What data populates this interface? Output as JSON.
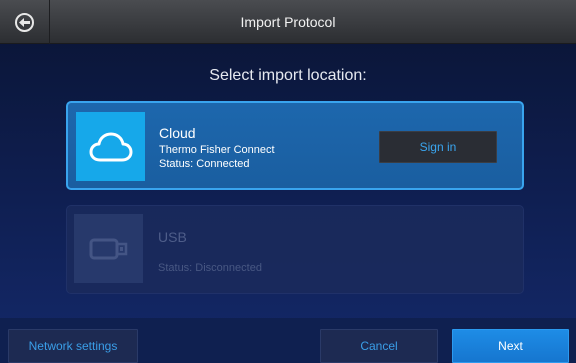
{
  "header": {
    "title": "Import Protocol",
    "back_icon": "back-arrow-icon"
  },
  "prompt": "Select import location:",
  "locations": [
    {
      "name": "Cloud",
      "provider": "Thermo Fisher Connect",
      "status": "Status: Connected",
      "icon": "cloud-icon",
      "action_label": "Sign in",
      "selected": true
    },
    {
      "name": "USB",
      "status": "Status: Disconnected",
      "icon": "usb-drive-icon",
      "selected": false
    }
  ],
  "footer": {
    "network_label": "Network settings",
    "cancel_label": "Cancel",
    "next_label": "Next"
  },
  "colors": {
    "accent": "#1e8ce6",
    "selected_border": "#39a4ee",
    "cloud_icon_bg": "#16a8ea",
    "link_text": "#3a9ee8"
  }
}
